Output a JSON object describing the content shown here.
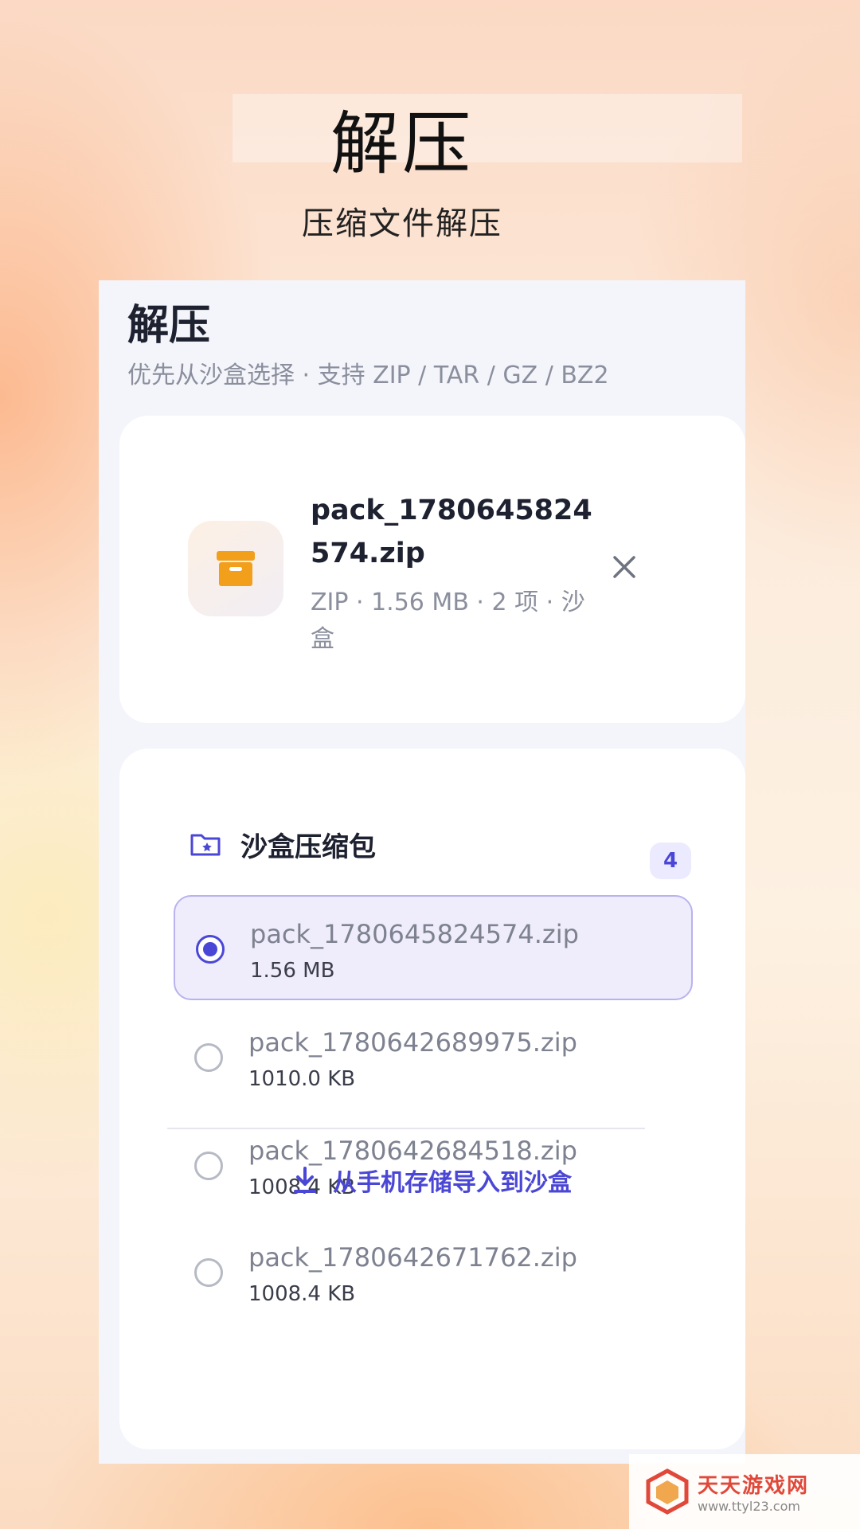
{
  "promo": {
    "title": "解压",
    "subtitle": "压缩文件解压"
  },
  "app": {
    "title": "解压",
    "subtitle": "优先从沙盒选择 · 支持 ZIP / TAR / GZ / BZ2"
  },
  "selected_file": {
    "icon": "archive-box-icon",
    "name": "pack_1780645824574.zip",
    "meta": "ZIP · 1.56 MB · 2 项 · 沙盒",
    "close_icon": "close-icon"
  },
  "sandbox_list": {
    "icon": "folder-star-icon",
    "title": "沙盒压缩包",
    "count": "4",
    "items": [
      {
        "name": "pack_1780645824574.zip",
        "size": "1.56 MB",
        "selected": true
      },
      {
        "name": "pack_1780642689975.zip",
        "size": "1010.0 KB",
        "selected": false
      },
      {
        "name": "pack_1780642684518.zip",
        "size": "1008.4 KB",
        "selected": false
      },
      {
        "name": "pack_1780642671762.zip",
        "size": "1008.4 KB",
        "selected": false
      }
    ],
    "import_icon": "download-icon",
    "import_label": "从手机存储导入到沙盒"
  },
  "watermark": {
    "main": "天天游戏网",
    "sub": "www.ttyl23.com"
  },
  "colors": {
    "accent": "#4b47d6",
    "archive_icon": "#f2a01c",
    "selected_row_bg": "#efedfc"
  }
}
